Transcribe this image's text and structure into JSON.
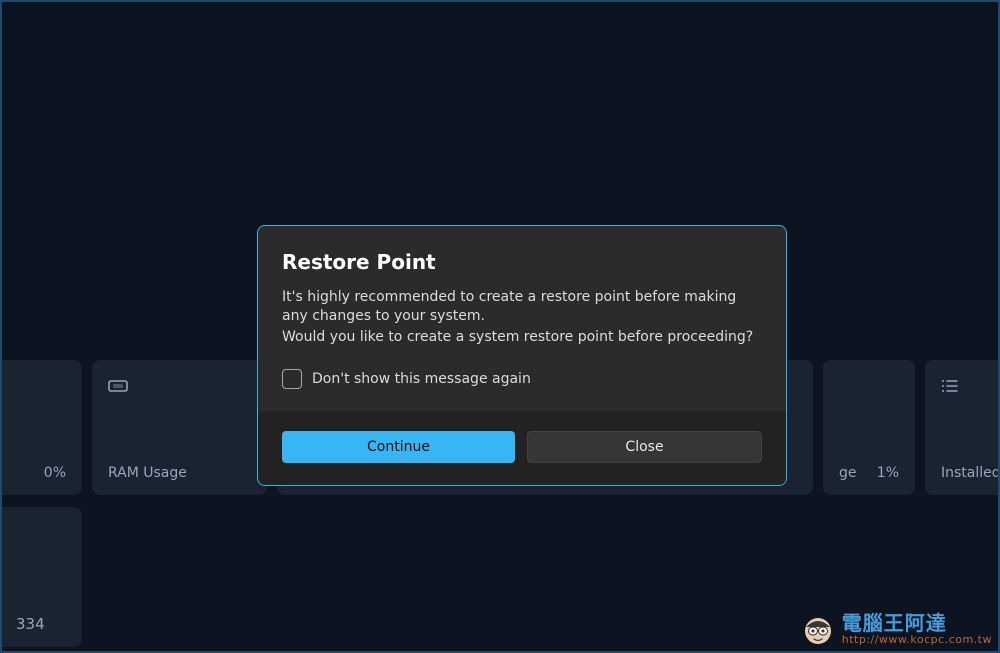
{
  "cards": {
    "cpu_value": "0%",
    "ram_label": "RAM Usage",
    "usage_trunc_label": "ge",
    "usage_trunc_value": "1%",
    "installed_label": "Installed"
  },
  "second_row": {
    "number": "334"
  },
  "modal": {
    "title": "Restore Point",
    "body_line1": "It's highly recommended to create a restore point before making any changes to your system.",
    "body_line2": "Would you like to create a system restore point before proceeding?",
    "checkbox_label": "Don't show this message again",
    "continue_label": "Continue",
    "close_label": "Close"
  },
  "watermark": {
    "main": "電腦王阿達",
    "sub": "http://www.kocpc.com.tw"
  }
}
